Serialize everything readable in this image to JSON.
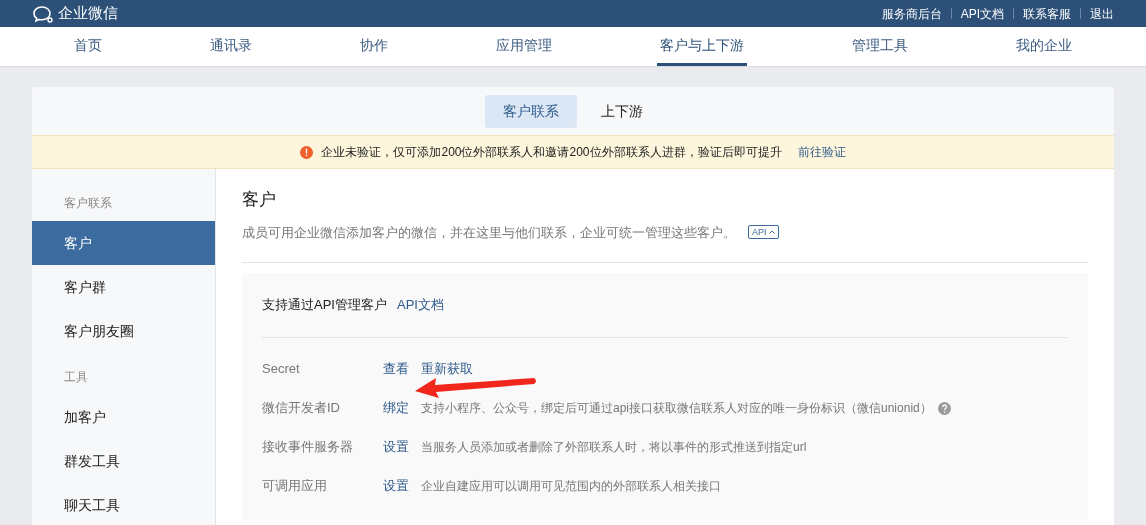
{
  "header": {
    "logo_text": "企业微信",
    "links": [
      "服务商后台",
      "API文档",
      "联系客服",
      "退出"
    ]
  },
  "nav": [
    {
      "label": "首页",
      "selected": false
    },
    {
      "label": "通讯录",
      "selected": false
    },
    {
      "label": "协作",
      "selected": false
    },
    {
      "label": "应用管理",
      "selected": false
    },
    {
      "label": "客户与上下游",
      "selected": true
    },
    {
      "label": "管理工具",
      "selected": false
    },
    {
      "label": "我的企业",
      "selected": false
    }
  ],
  "subtabs": [
    {
      "label": "客户联系",
      "selected": true
    },
    {
      "label": "上下游",
      "selected": false
    }
  ],
  "notice": {
    "text": "企业未验证，仅可添加200位外部联系人和邀请200位外部联系人进群，验证后即可提升",
    "link": "前往验证"
  },
  "sidebar": [
    {
      "title": "客户联系",
      "items": [
        {
          "label": "客户",
          "selected": true
        },
        {
          "label": "客户群",
          "selected": false
        },
        {
          "label": "客户朋友圈",
          "selected": false
        }
      ]
    },
    {
      "title": "工具",
      "items": [
        {
          "label": "加客户",
          "selected": false
        },
        {
          "label": "群发工具",
          "selected": false
        },
        {
          "label": "聊天工具",
          "selected": false
        }
      ]
    }
  ],
  "content": {
    "title": "客户",
    "description": "成员可用企业微信添加客户的微信，并在这里与他们联系，企业可统一管理这些客户。",
    "api_toggle": "API",
    "api_panel": {
      "heading": "支持通过API管理客户",
      "doc_link": "API文档",
      "rows": [
        {
          "label": "Secret",
          "actions": [
            "查看",
            "重新获取"
          ],
          "note": "",
          "help": false
        },
        {
          "label": "微信开发者ID",
          "actions": [
            "绑定"
          ],
          "note": "支持小程序、公众号，绑定后可通过api接口获取微信联系人对应的唯一身份标识（微信unionid）",
          "help": true
        },
        {
          "label": "接收事件服务器",
          "actions": [
            "设置"
          ],
          "note": "当服务人员添加或者删除了外部联系人时，将以事件的形式推送到指定url",
          "help": false
        },
        {
          "label": "可调用应用",
          "actions": [
            "设置"
          ],
          "note": "企业自建应用可以调用可见范围内的外部联系人相关接口",
          "help": false
        }
      ]
    }
  }
}
